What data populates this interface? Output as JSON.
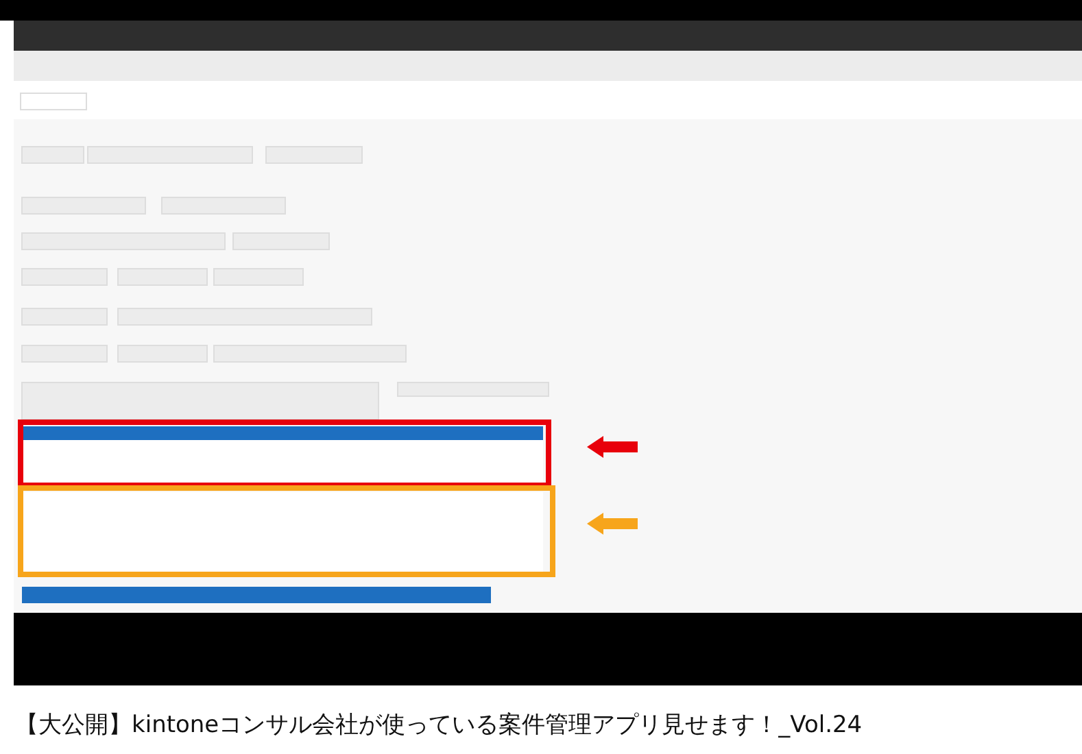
{
  "video_title": "【大公開】kintoneコンサル会社が使っている案件管理アプリ見せます！_Vol.24"
}
